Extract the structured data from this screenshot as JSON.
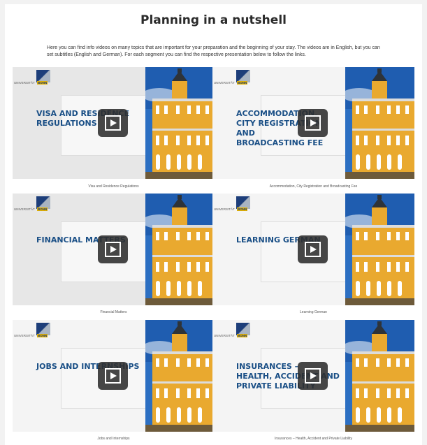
{
  "header": {
    "title": "Planning in a nutshell",
    "intro": "Here you can find info videos on many topics that are important for your preparation and the beginning of your stay. The videos are in English, but you can set subtitles (English and German). For each segment you can find the respective presentation below to follow the links."
  },
  "logo": {
    "text": "UNIVERSITÄT",
    "badge": "BONN"
  },
  "videos": [
    {
      "title": "VISA AND RESIDENCE\nREGULATIONS",
      "caption": "Visa and Residence Regulations"
    },
    {
      "title": "ACCOMMODATION,\nCITY REGISTRATION\nAND\nBROADCASTING FEE",
      "caption": "Accommodation, City Registration and Broadcasting Fee"
    },
    {
      "title": "FINANCIAL MATTERS",
      "caption": "Financial Matters"
    },
    {
      "title": "LEARNING GERMAN",
      "caption": "Learning German"
    },
    {
      "title": "JOBS AND INTERNSHIPS",
      "caption": "Jobs and Internships"
    },
    {
      "title": "INSURANCES –\nHEALTH, ACCIDENT AND\nPRIVATE LIABILITY",
      "caption": "Insurances – Health, Accident and Private Liability"
    }
  ],
  "icons": {
    "play": "play-icon"
  },
  "colors": {
    "accent": "#1a4f86",
    "bonn_yellow": "#e6b300"
  }
}
